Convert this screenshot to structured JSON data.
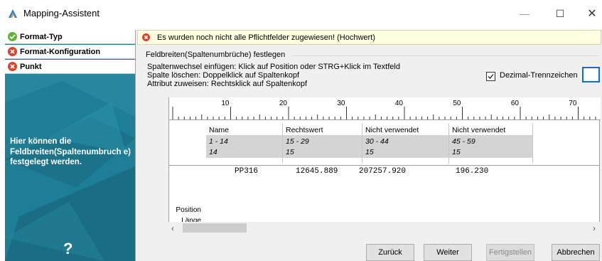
{
  "window": {
    "title": "Mapping-Assistent",
    "min_glyph": "—",
    "max_glyph": "☐",
    "close_glyph": "✕"
  },
  "sidebar": {
    "steps": [
      {
        "label": "Format-Typ",
        "status": "ok"
      },
      {
        "label": "Format-Konfiguration",
        "status": "error"
      },
      {
        "label": "Punkt",
        "status": "error"
      }
    ],
    "description": "Hier können die Feldbreiten(Spaltenumbruch e) festgelegt werden.",
    "help_glyph": "?"
  },
  "banner": {
    "message": "Es wurden noch nicht alle Pflichtfelder zugewiesen! (Hochwert)"
  },
  "group": {
    "title": "Feldbreiten(Spaltenumbrüche) festlegen",
    "instructions": [
      "Spaltenwechsel einfügen: Klick auf Position oder STRG+Klick im Textfeld",
      "Spalte löschen: Doppelklick auf Spaltenkopf",
      "Attribut zuweisen: Rechtsklick auf Spaltenkopf"
    ]
  },
  "decimal": {
    "label": "Dezimal-Trennzeichen",
    "checked": true,
    "value": ""
  },
  "ruler": {
    "ticks": [
      "10",
      "20",
      "30",
      "40",
      "50",
      "60",
      "70"
    ]
  },
  "table": {
    "row_labels": {
      "position": "Position",
      "length": "Länge"
    },
    "columns": [
      {
        "name": "Name",
        "position": "1 - 14",
        "length": "14"
      },
      {
        "name": "Rechtswert",
        "position": "15 - 29",
        "length": "15"
      },
      {
        "name": "Nicht verwendet",
        "position": "30 - 44",
        "length": "15"
      },
      {
        "name": "Nicht verwendet",
        "position": "45 - 59",
        "length": "15"
      }
    ]
  },
  "preview": {
    "values": [
      "PP316",
      "12645.889",
      "207257.920",
      "196.230"
    ]
  },
  "scroll": {
    "left_glyph": "‹",
    "right_glyph": "›"
  },
  "buttons": {
    "back": "Zurück",
    "next": "Weiter",
    "finish": "Fertigstellen",
    "cancel": "Abbrechen"
  },
  "colors": {
    "sidebar_bg": "#1e7e95",
    "ok": "#5fb532",
    "error": "#d9432e",
    "banner_bg": "#ffffe1",
    "focus": "#0b6fd6"
  }
}
